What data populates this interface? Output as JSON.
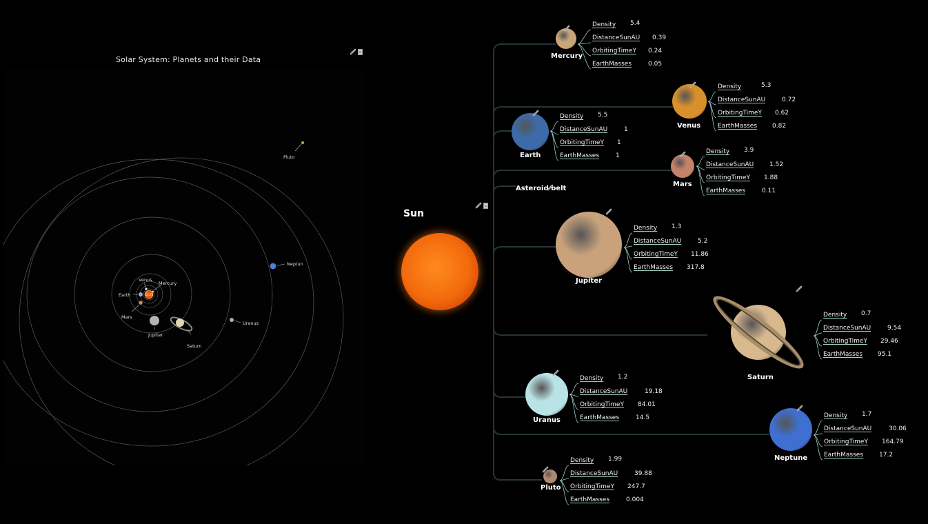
{
  "left_panel": {
    "title": "Solar System: Planets and their Data",
    "icons": [
      "link-icon",
      "note-icon"
    ],
    "orbit_labels": {
      "sun": "Sun",
      "mercury": "Mercury",
      "venus": "Venus",
      "earth": "Earth",
      "mars": "Mars",
      "jupiter": "Jupiter",
      "saturn": "Saturn",
      "uranus": "Uranus",
      "neptune": "Neptun",
      "pluto": "Pluto"
    }
  },
  "mindmap": {
    "root": {
      "title": "Sun",
      "icons": [
        "link-icon",
        "note-icon"
      ]
    },
    "attribute_names": [
      "Density",
      "DistanceSunAU",
      "OrbitingTimeY",
      "EarthMasses"
    ],
    "nodes": [
      {
        "name": "Mercury",
        "color": "#c9a57a",
        "values": [
          "5.4",
          "0.39",
          "0.24",
          "0.05"
        ]
      },
      {
        "name": "Venus",
        "color": "#d9902a",
        "values": [
          "5.3",
          "0.72",
          "0.62",
          "0.82"
        ]
      },
      {
        "name": "Earth",
        "color": "#3d6aa8",
        "values": [
          "5.5",
          "1",
          "1",
          "1"
        ]
      },
      {
        "name": "Mars",
        "color": "#c4826a",
        "values": [
          "3.9",
          "1.52",
          "1.88",
          "0.11"
        ]
      },
      {
        "name": "Asteroid belt",
        "color": "",
        "values": []
      },
      {
        "name": "Jupiter",
        "color": "#c9a27c",
        "values": [
          "1.3",
          "5.2",
          "11.86",
          "317.8"
        ]
      },
      {
        "name": "Saturn",
        "color": "#d8b98e",
        "values": [
          "0.7",
          "9.54",
          "29.46",
          "95.1"
        ]
      },
      {
        "name": "Uranus",
        "color": "#b9e3e6",
        "values": [
          "1.2",
          "19.18",
          "84.01",
          "14.5"
        ]
      },
      {
        "name": "Neptune",
        "color": "#3f6fd0",
        "values": [
          "1.7",
          "30.06",
          "164.79",
          "17.2"
        ]
      },
      {
        "name": "Pluto",
        "color": "#b08870",
        "values": [
          "1.99",
          "39.88",
          "247.7",
          "0.004"
        ]
      }
    ]
  },
  "colors": {
    "background": "#000000",
    "connector": "#26353a",
    "attr_connector": "#9ccfc6",
    "orbit": "#5a5a5a"
  }
}
